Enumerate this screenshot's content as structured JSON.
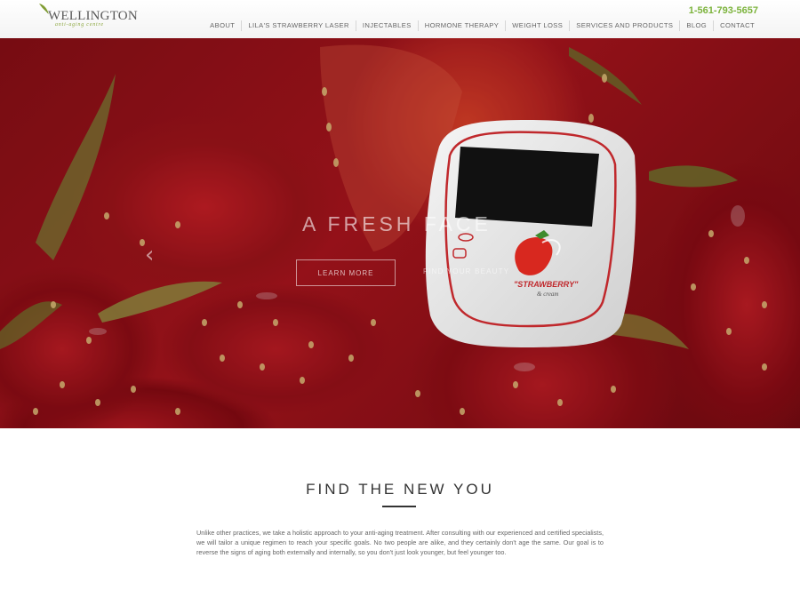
{
  "header": {
    "logo_name": "WELLINGTON",
    "logo_tagline": "anti-aging centre",
    "phone": "1-561-793-5657",
    "nav": [
      "ABOUT",
      "LILA'S STRAWBERRY LASER",
      "INJECTABLES",
      "HORMONE THERAPY",
      "WEIGHT LOSS",
      "SERVICES AND PRODUCTS",
      "BLOG",
      "CONTACT"
    ]
  },
  "hero": {
    "title": "A FRESH FACE",
    "button_label": "LEARN MORE",
    "subtext": "FIND YOUR BEAUTY",
    "arrow": "‹",
    "device_label_line1": "\"STRAWBERRY\"",
    "device_label_line2": "& cream"
  },
  "main": {
    "heading": "FIND THE NEW YOU",
    "body": "Unlike other practices, we take a holistic approach to your anti-aging treatment. After consulting with our experienced and certified specialists, we will tailor a unique regimen to reach your specific goals. No two people are alike, and they certainly don't age the same. Our goal is to reverse the signs of aging both externally and internally, so you don't just look younger, but feel younger too."
  },
  "colors": {
    "accent_green": "#7cb33c",
    "hero_red": "#b2171f",
    "text_dark": "#333333"
  },
  "icons": [
    "leaf-logo-icon",
    "chevron-left-icon"
  ]
}
